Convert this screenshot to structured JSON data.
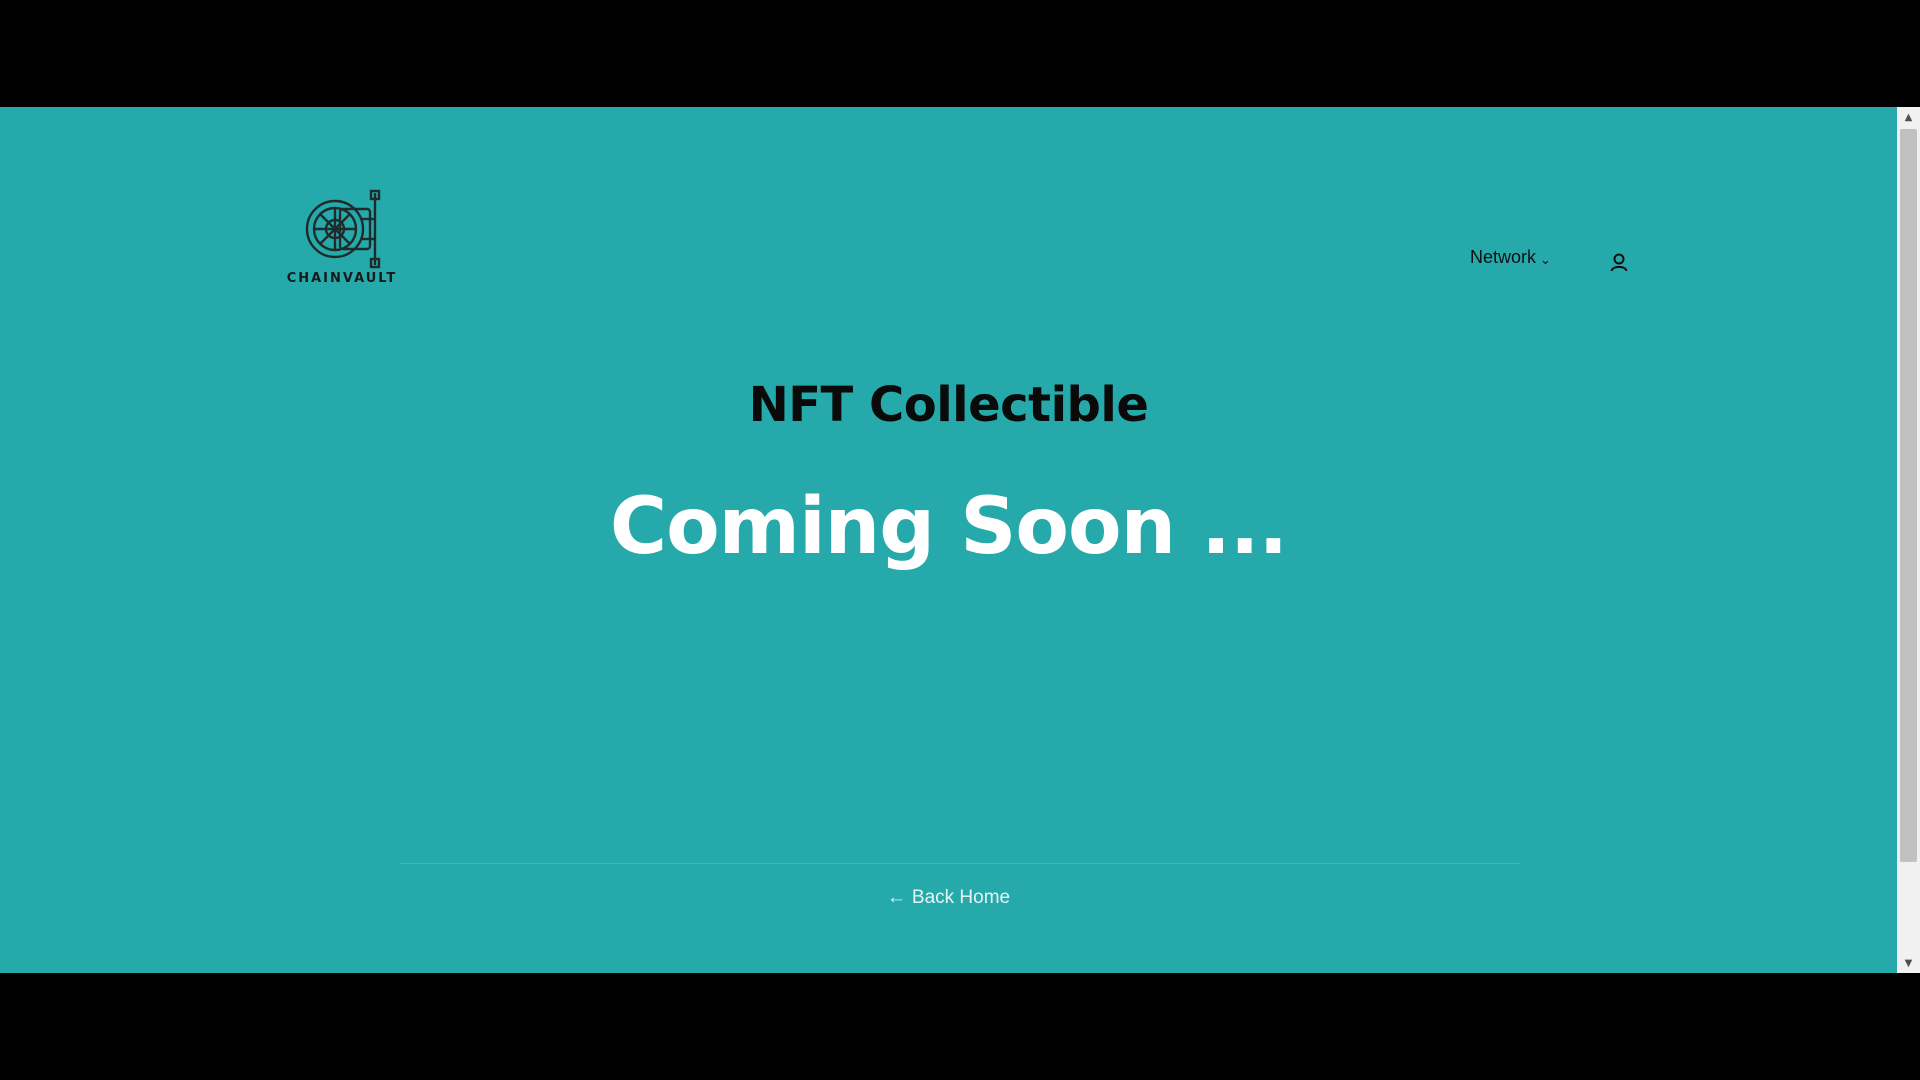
{
  "brand": {
    "logo_text": "CHAINVAULT"
  },
  "nav": {
    "network_label": "Network",
    "network_chevron": "chevron-down-icon",
    "user_icon": "user-icon"
  },
  "main": {
    "title": "NFT Collectible",
    "subtitle": "Coming Soon ..."
  },
  "footer": {
    "back_home_label": "Back Home",
    "back_icon": "arrow-left-icon"
  },
  "colors": {
    "background": "#26a9ab",
    "title": "#0a0a0a",
    "subtitle": "#ffffff",
    "letterbox": "#000000"
  }
}
